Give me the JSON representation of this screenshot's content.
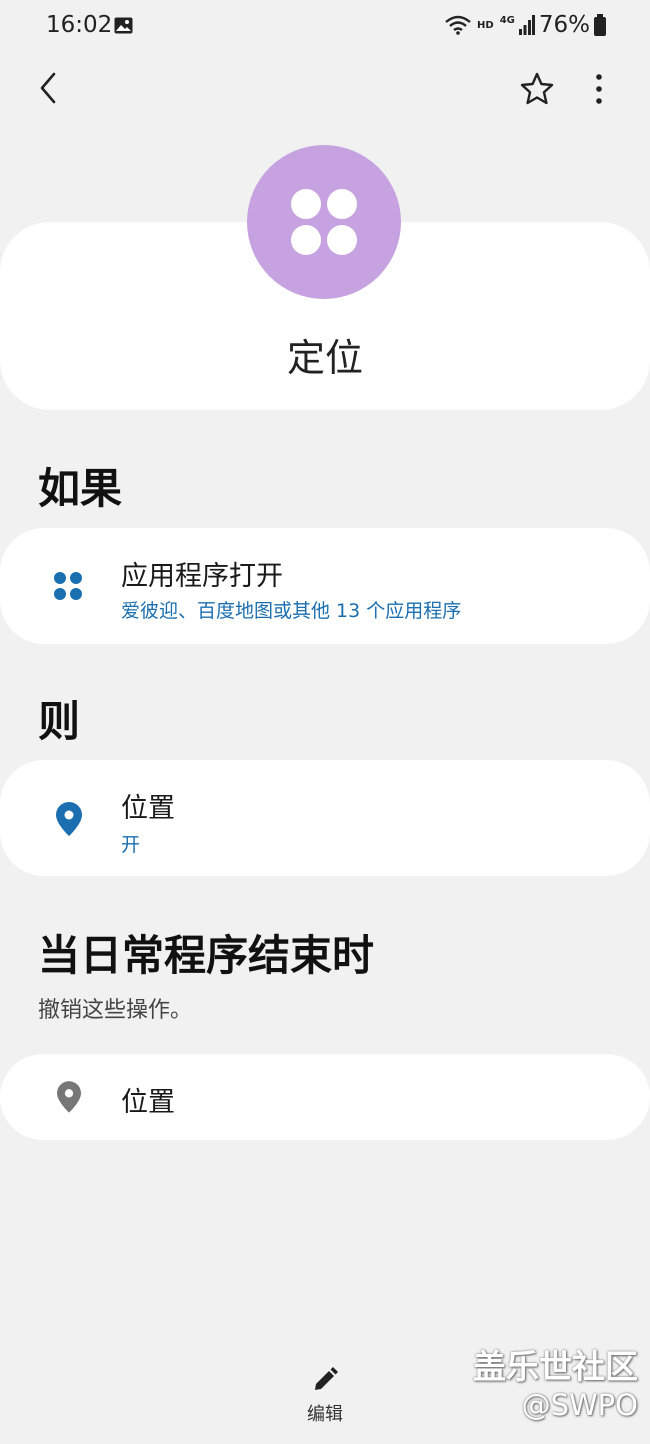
{
  "status_bar": {
    "time": "16:02",
    "network_hd": "HD",
    "network_type": "4G",
    "battery": "76%",
    "icons": [
      "image-icon",
      "wifi-icon",
      "signal-icon",
      "battery-icon"
    ]
  },
  "top_bar": {
    "icons": [
      "back-icon",
      "star-icon",
      "more-icon"
    ]
  },
  "header": {
    "icon": "apps-grid-icon",
    "icon_color": "#c6a2e0",
    "title": "定位"
  },
  "if_section": {
    "heading": "如果",
    "card": {
      "icon": "apps-grid-icon",
      "title": "应用程序打开",
      "subtitle": "爱彼迎、百度地图或其他 13 个应用程序"
    }
  },
  "then_section": {
    "heading": "则",
    "card": {
      "icon": "location-pin-icon",
      "title": "位置",
      "subtitle": "开"
    }
  },
  "end_section": {
    "heading": "当日常程序结束时",
    "description": "撤销这些操作。",
    "card": {
      "icon": "location-pin-icon",
      "title": "位置"
    }
  },
  "bottom_bar": {
    "edit_label": "编辑",
    "icon": "pencil-icon"
  },
  "watermark": {
    "line1": "盖乐世社区",
    "line2": "@SWPO"
  },
  "colors": {
    "accent": "#1b6fb0",
    "background": "#f1f1f1",
    "card": "#ffffff"
  }
}
